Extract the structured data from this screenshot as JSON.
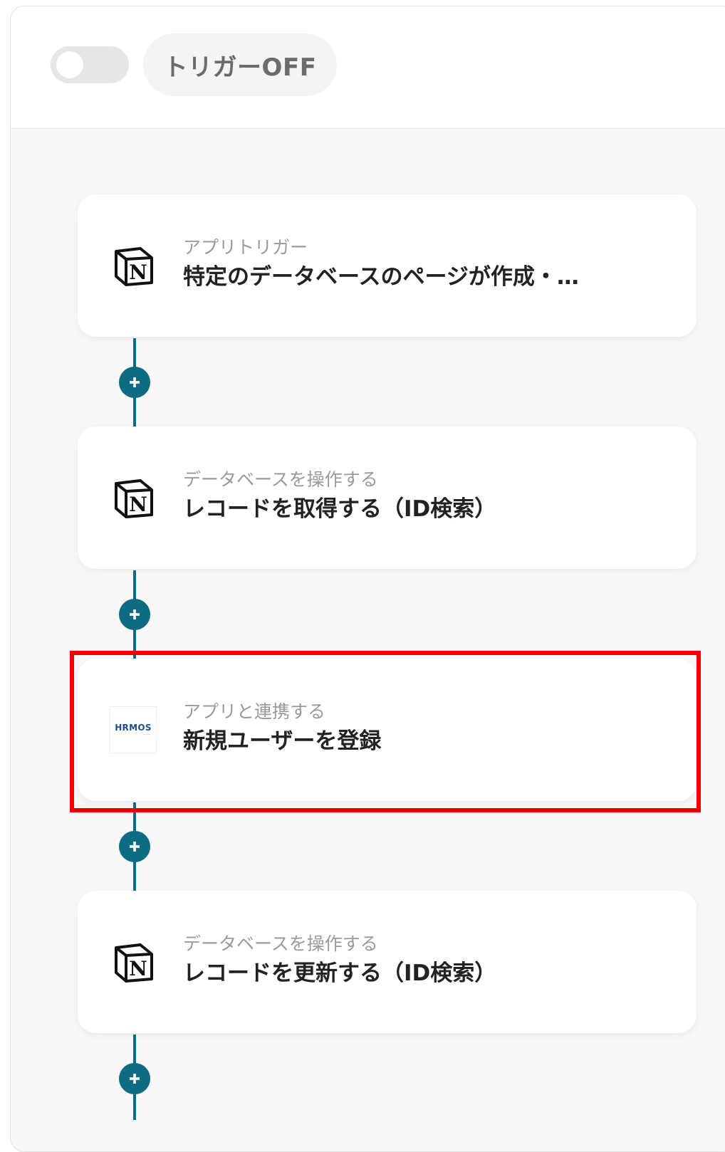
{
  "header": {
    "toggle_state": "off",
    "trigger_label": "トリガーOFF"
  },
  "steps": [
    {
      "app_icon": "notion-icon",
      "label": "アプリトリガー",
      "title": "特定のデータベースのページが作成・…"
    },
    {
      "app_icon": "notion-icon",
      "label": "データベースを操作する",
      "title": "レコードを取得する（ID検索）"
    },
    {
      "app_icon": "hrmos-icon",
      "logo_text": "HRMOS",
      "label": "アプリと連携する",
      "title": "新規ユーザーを登録"
    },
    {
      "app_icon": "notion-icon",
      "label": "データベースを操作する",
      "title": "レコードを更新する（ID検索）"
    }
  ],
  "colors": {
    "connector": "#0d6b83",
    "highlight": "#ee0000"
  }
}
